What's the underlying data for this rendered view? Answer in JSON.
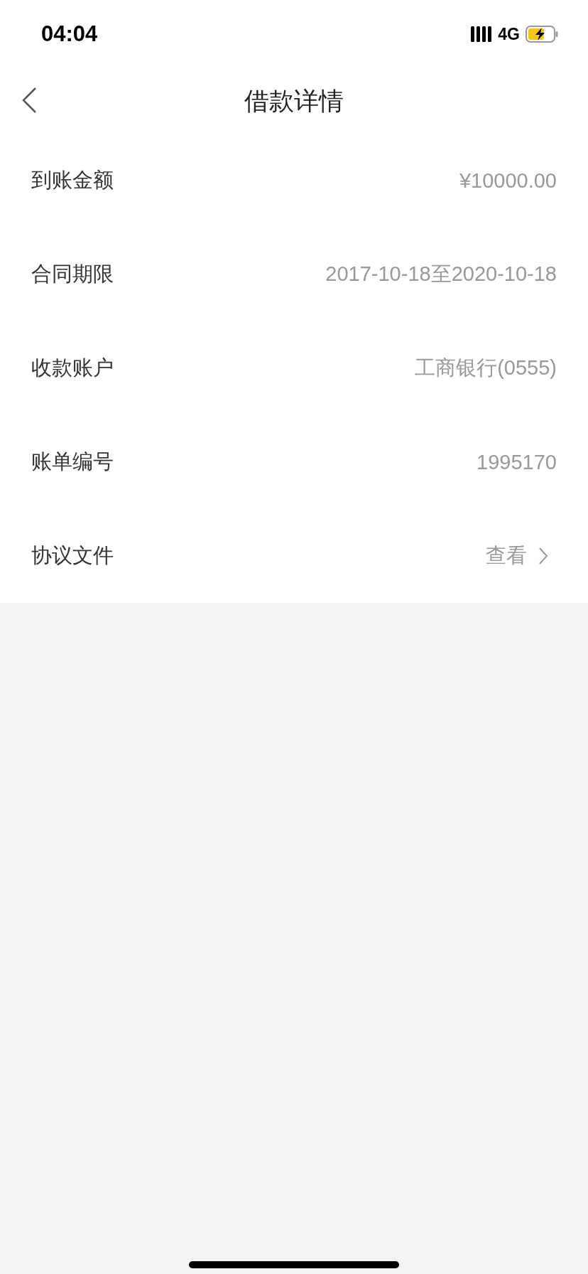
{
  "status_bar": {
    "time": "04:04",
    "network": "4G"
  },
  "nav": {
    "title": "借款详情"
  },
  "rows": [
    {
      "kind": "text",
      "label": "到账金额",
      "value": "¥10000.00"
    },
    {
      "kind": "text",
      "label": "合同期限",
      "value": "2017-10-18至2020-10-18"
    },
    {
      "kind": "text",
      "label": "收款账户",
      "value": "工商银行(0555)"
    },
    {
      "kind": "text",
      "label": "账单编号",
      "value": "1995170"
    },
    {
      "kind": "link",
      "label": "协议文件",
      "value": "查看"
    }
  ]
}
